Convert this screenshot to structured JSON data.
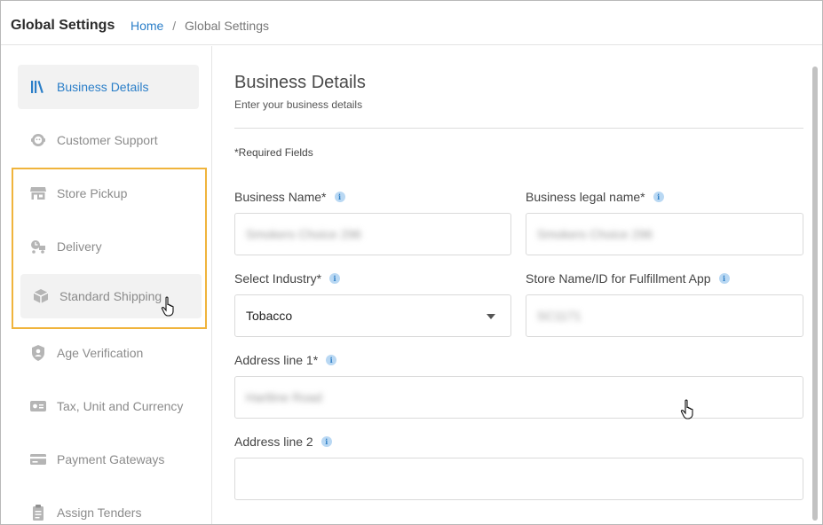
{
  "header": {
    "title": "Global Settings",
    "breadcrumb_home": "Home",
    "breadcrumb_separator": "/",
    "breadcrumb_current": "Global Settings"
  },
  "sidebar": {
    "items": [
      {
        "label": "Business Details",
        "icon": "books-icon",
        "state": "active"
      },
      {
        "label": "Customer Support",
        "icon": "support-agent-icon",
        "state": "normal"
      },
      {
        "label": "Store Pickup",
        "icon": "storefront-icon",
        "state": "normal"
      },
      {
        "label": "Delivery",
        "icon": "delivery-icon",
        "state": "normal"
      },
      {
        "label": "Standard Shipping",
        "icon": "package-icon",
        "state": "hovered"
      },
      {
        "label": "Age Verification",
        "icon": "shield-user-icon",
        "state": "normal"
      },
      {
        "label": "Tax, Unit and Currency",
        "icon": "currency-icon",
        "state": "normal"
      },
      {
        "label": "Payment Gateways",
        "icon": "credit-card-icon",
        "state": "normal"
      },
      {
        "label": "Assign Tenders",
        "icon": "clipboard-list-icon",
        "state": "normal"
      }
    ]
  },
  "main": {
    "title": "Business Details",
    "subtitle": "Enter your business details",
    "required_note": "*Required Fields",
    "fields": {
      "business_name": {
        "label": "Business Name*",
        "value": "Smokers Choice 296"
      },
      "business_legal_name": {
        "label": "Business legal name*",
        "value": "Smokers Choice 296"
      },
      "industry": {
        "label": "Select Industry*",
        "value": "Tobacco"
      },
      "store_name": {
        "label": "Store Name/ID for Fulfillment App",
        "value": "SC1171"
      },
      "address1": {
        "label": "Address line 1*",
        "value": "Hartline Road"
      },
      "address2": {
        "label": "Address line 2",
        "value": ""
      }
    },
    "info_glyph": "i"
  },
  "colors": {
    "accent": "#2a7ec8",
    "highlight_border": "#f0b43c",
    "active_bg": "#f2f2f2"
  }
}
